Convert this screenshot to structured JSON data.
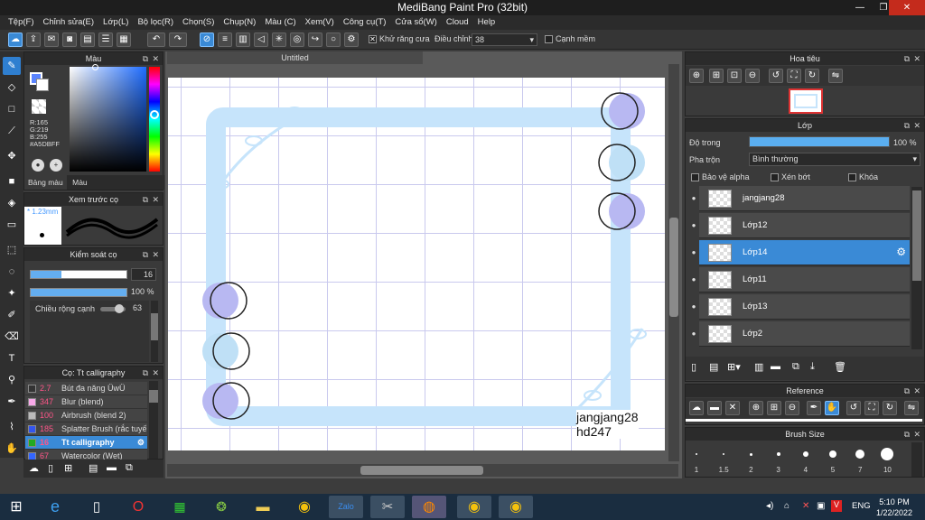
{
  "window": {
    "title": "MediBang Paint Pro (32bit)",
    "minimize": "—",
    "restore": "❐",
    "close": "✕"
  },
  "menu": [
    "Tệp(F)",
    "Chỉnh sửa(E)",
    "Lớp(L)",
    "Bộ lọc(R)",
    "Chọn(S)",
    "Chụp(N)",
    "Màu (C)",
    "Xem(V)",
    "Công cụ(T)",
    "Cửa sổ(W)",
    "Cloud",
    "Help"
  ],
  "toolbar": {
    "antialias_label": "Khử răng cưa",
    "correction_label": "Điều chỉnh",
    "correction_value": "38",
    "snap_label": "Cạnh mềm"
  },
  "color_panel": {
    "title": "Màu",
    "r": "R:165",
    "g": "G:219",
    "b": "B:255",
    "hex": "#A5DBFF",
    "tab_palette": "Bảng màu",
    "tab_color": "Màu",
    "accent": "#A5DBFF"
  },
  "brush_preview": {
    "title": "Xem trước cọ",
    "size": "1.23mm"
  },
  "brush_control": {
    "title": "Kiểm soát cọ",
    "size": "16",
    "opacity": "100 %",
    "edge_label": "Chiều rộng cạnh",
    "edge_value": "63"
  },
  "brush_list": {
    "title": "Cọ: Tt calligraphy",
    "items": [
      {
        "num": "2.7",
        "name": "Bút đa năng ÜwÜ",
        "color": "#333333"
      },
      {
        "num": "347",
        "name": "Blur (blend)",
        "color": "#f7a8e8"
      },
      {
        "num": "100",
        "name": "Airbrush (blend 2)",
        "color": "#bbbbbb"
      },
      {
        "num": "185",
        "name": "Splatter Brush (rắc tuyết)",
        "color": "#3355ee"
      },
      {
        "num": "16",
        "name": "Tt calligraphy",
        "color": "#22aa22"
      },
      {
        "num": "67",
        "name": "Watercolor (Wet)",
        "color": "#3366ff"
      }
    ]
  },
  "document": {
    "tab": "Untitled",
    "signature_line1": "jangjang28",
    "signature_line2": "hd247"
  },
  "navigator": {
    "title": "Hoa tiêu"
  },
  "layer_panel": {
    "title": "Lớp",
    "opacity_label": "Độ trong",
    "opacity_value": "100 %",
    "opacity_fraction": 1.0,
    "blend_label": "Pha trộn",
    "blend_value": "Bình thường",
    "protect_alpha": "Bảo vệ alpha",
    "clipping": "Xén bớt",
    "lock": "Khóa",
    "layers": [
      {
        "name": "jangjang28",
        "selected": false
      },
      {
        "name": "Lớp12",
        "selected": false
      },
      {
        "name": "Lớp14",
        "selected": true
      },
      {
        "name": "Lớp11",
        "selected": false
      },
      {
        "name": "Lớp13",
        "selected": false
      },
      {
        "name": "Lớp2",
        "selected": false
      }
    ]
  },
  "reference": {
    "title": "Reference"
  },
  "brush_size": {
    "title": "Brush Size",
    "sizes": [
      "1",
      "1.5",
      "2",
      "3",
      "4",
      "5",
      "7",
      "10"
    ]
  },
  "taskbar": {
    "time": "5:10 PM",
    "date": "1/22/2022",
    "lang": "ENG"
  }
}
